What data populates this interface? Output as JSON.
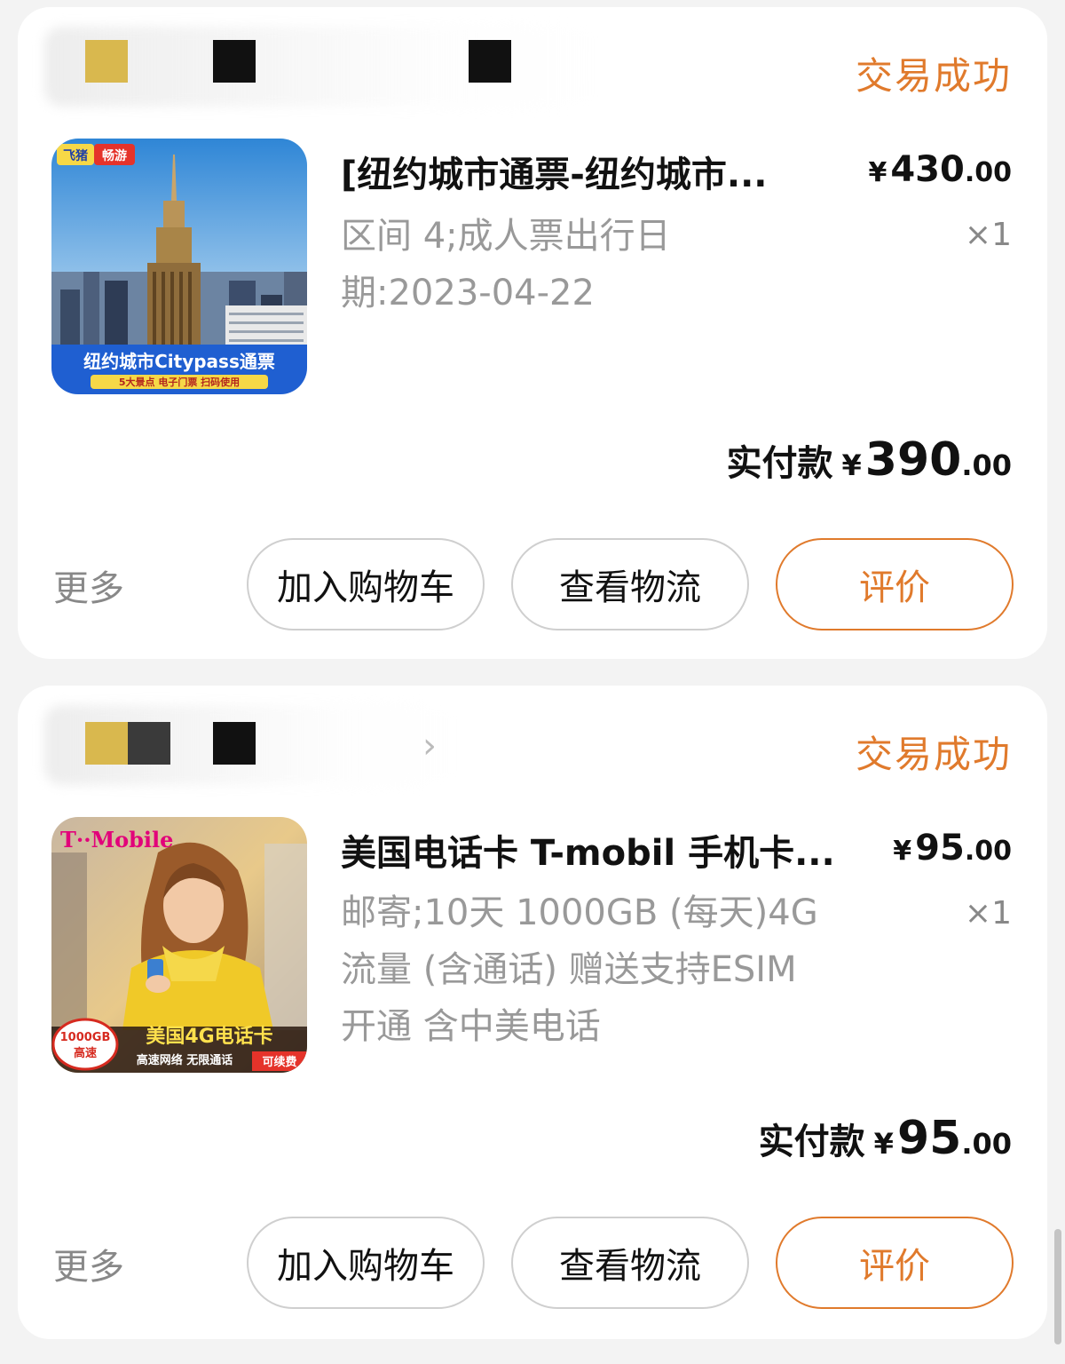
{
  "colors": {
    "accent": "#e07a2c",
    "background": "#f3f3f3",
    "card": "#ffffff",
    "muted": "#999999"
  },
  "orders": [
    {
      "shop": {
        "logo_colors": [
          "#d9b84e",
          "#111111"
        ],
        "icon": "blurred-shop-name"
      },
      "status": "交易成功",
      "thumbnail": {
        "icon": "new-york-city-skyline-image",
        "badge_tag": "飞猪",
        "badge_text": "畅游",
        "caption": "纽约城市Citypass通票",
        "subcaption": "5大景点 电子门票 扫码使用"
      },
      "title": "[纽约城市通票-纽约城市...",
      "price": {
        "symbol": "¥",
        "int": "430",
        "dec": ".00"
      },
      "quantity": "×1",
      "spec_lines": [
        "区间 4;成人票出行日",
        "期:2023-04-22"
      ],
      "paid": {
        "label": "实付款",
        "symbol": "¥",
        "int": "390",
        "dec": ".00"
      },
      "more": "更多",
      "buttons": {
        "cart": "加入购物车",
        "logistics": "查看物流",
        "review": "评价"
      }
    },
    {
      "shop": {
        "logo_colors": [
          "#d9b84e",
          "#3a3a3a",
          "#111111"
        ],
        "icon": "blurred-shop-name",
        "chevron": "›"
      },
      "status": "交易成功",
      "thumbnail": {
        "icon": "tmobile-sim-card-woman-image",
        "brand": "T··Mobile",
        "caption": "美国4G电话卡",
        "badge": "1000GB",
        "badge_sub": "高速",
        "subcaption": "高速网络 无限通话",
        "tag": "可续费"
      },
      "title": "美国电话卡 T-mobil 手机卡...",
      "price": {
        "symbol": "¥",
        "int": "95",
        "dec": ".00"
      },
      "quantity": "×1",
      "spec_lines": [
        "邮寄;10天 1000GB (每天)4G",
        "流量 (含通话) 赠送支持ESIM",
        "开通 含中美电话"
      ],
      "paid": {
        "label": "实付款",
        "symbol": "¥",
        "int": "95",
        "dec": ".00"
      },
      "more": "更多",
      "buttons": {
        "cart": "加入购物车",
        "logistics": "查看物流",
        "review": "评价"
      }
    }
  ]
}
